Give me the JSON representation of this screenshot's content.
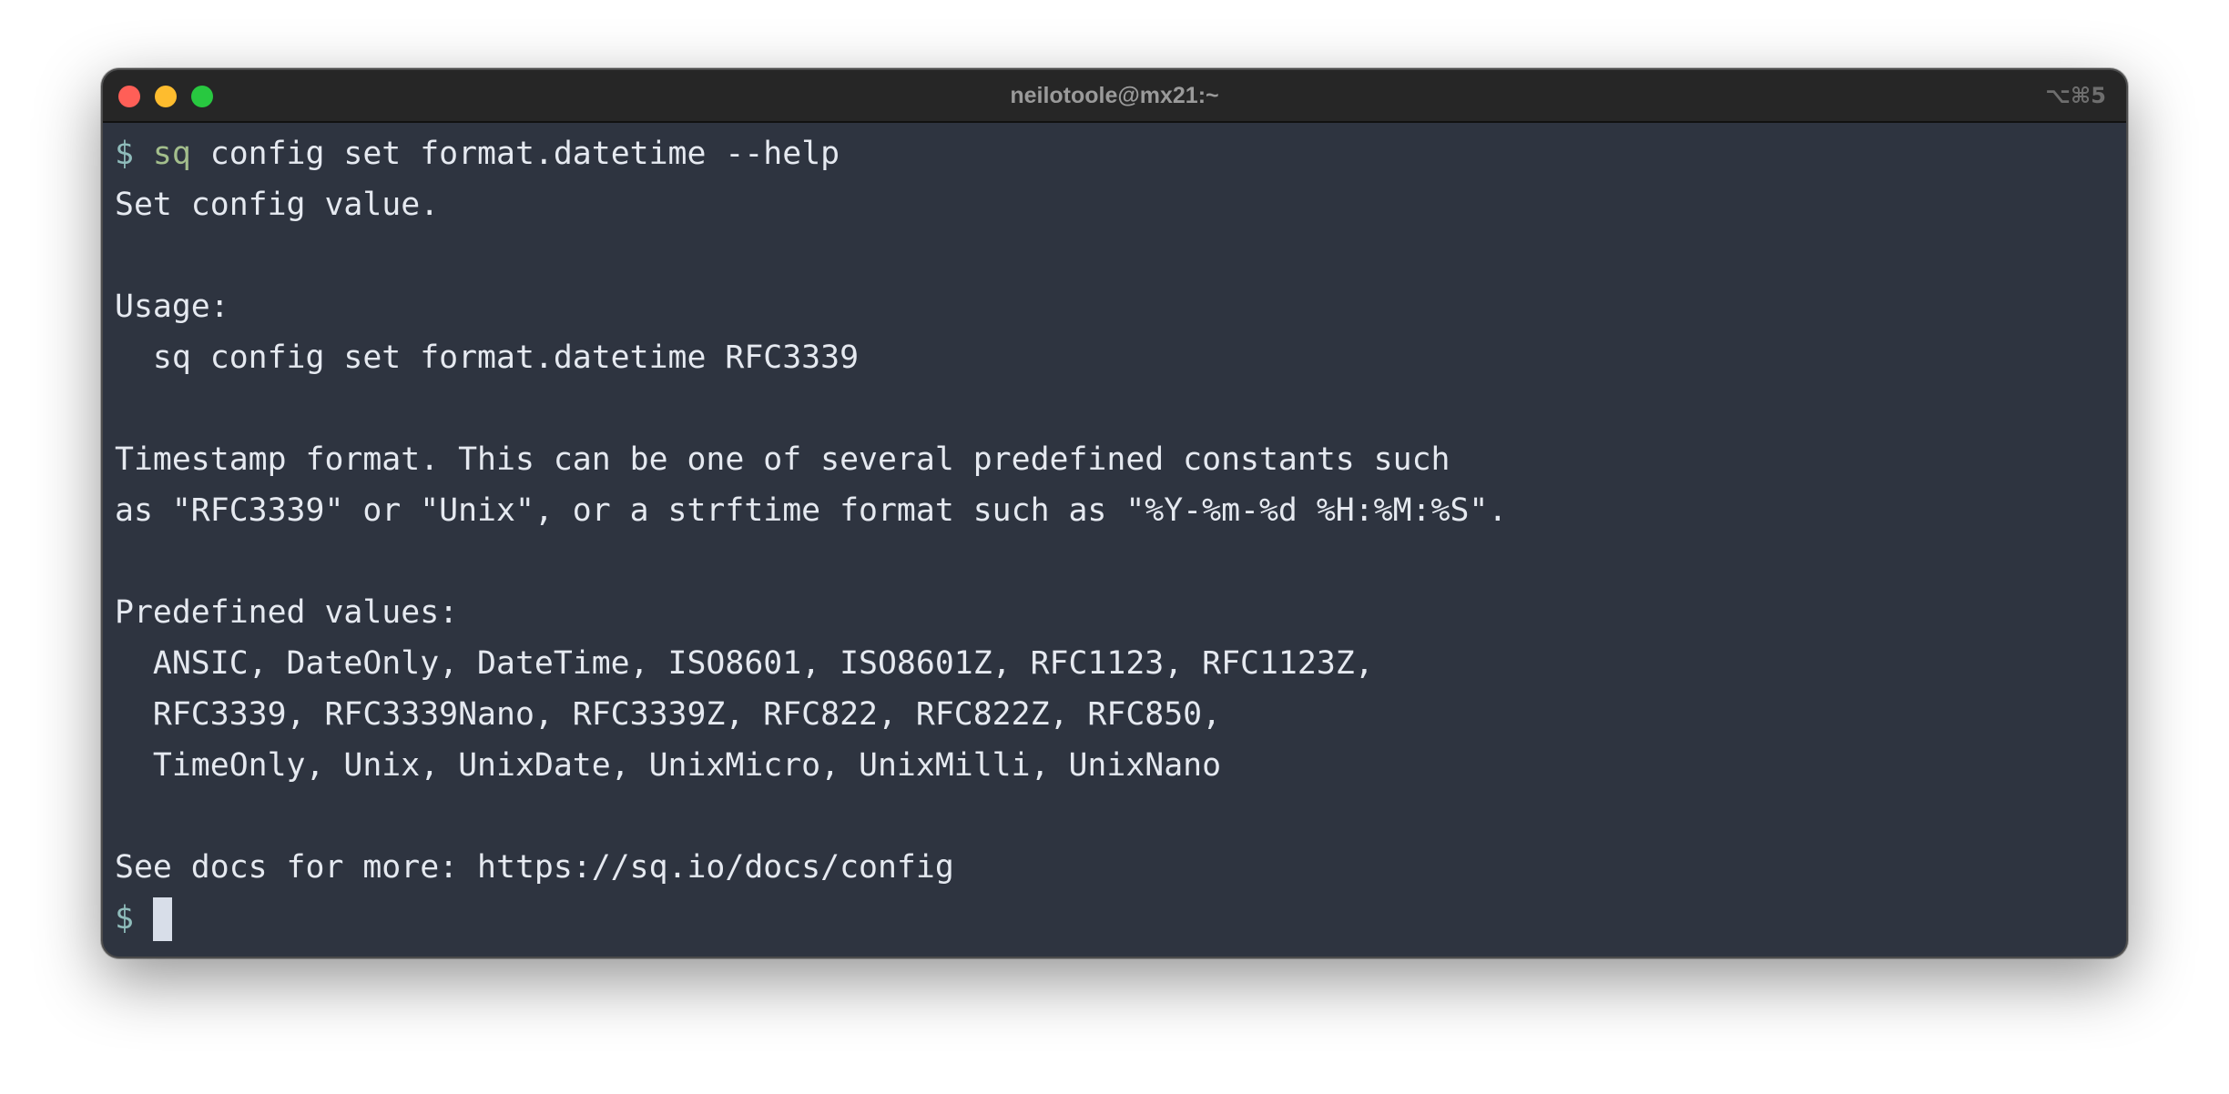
{
  "window": {
    "title": "neilotoole@mx21:~",
    "shortcut": "⌥⌘5"
  },
  "terminal": {
    "prompt_symbol": "$",
    "command_name": "sq",
    "command_args": " config set format.datetime --help",
    "lines": [
      "Set config value.",
      "",
      "Usage:",
      "  sq config set format.datetime RFC3339",
      "",
      "Timestamp format. This can be one of several predefined constants such",
      "as \"RFC3339\" or \"Unix\", or a strftime format such as \"%Y-%m-%d %H:%M:%S\".",
      "",
      "Predefined values:",
      "  ANSIC, DateOnly, DateTime, ISO8601, ISO8601Z, RFC1123, RFC1123Z,",
      "  RFC3339, RFC3339Nano, RFC3339Z, RFC822, RFC822Z, RFC850,",
      "  TimeOnly, Unix, UnixDate, UnixMicro, UnixMilli, UnixNano",
      "",
      "See docs for more: https://sq.io/docs/config"
    ],
    "final_prompt_symbol": "$"
  },
  "colors": {
    "background": "#2e3440",
    "text": "#e5e9f0",
    "prompt": "#8fbcbb",
    "command": "#a3be8c",
    "titlebar": "#262626",
    "close_button": "#ff5f57",
    "minimize_button": "#febc2e",
    "zoom_button": "#28c840"
  },
  "icons": [
    "close-icon",
    "minimize-icon",
    "zoom-icon",
    "cursor-block"
  ]
}
